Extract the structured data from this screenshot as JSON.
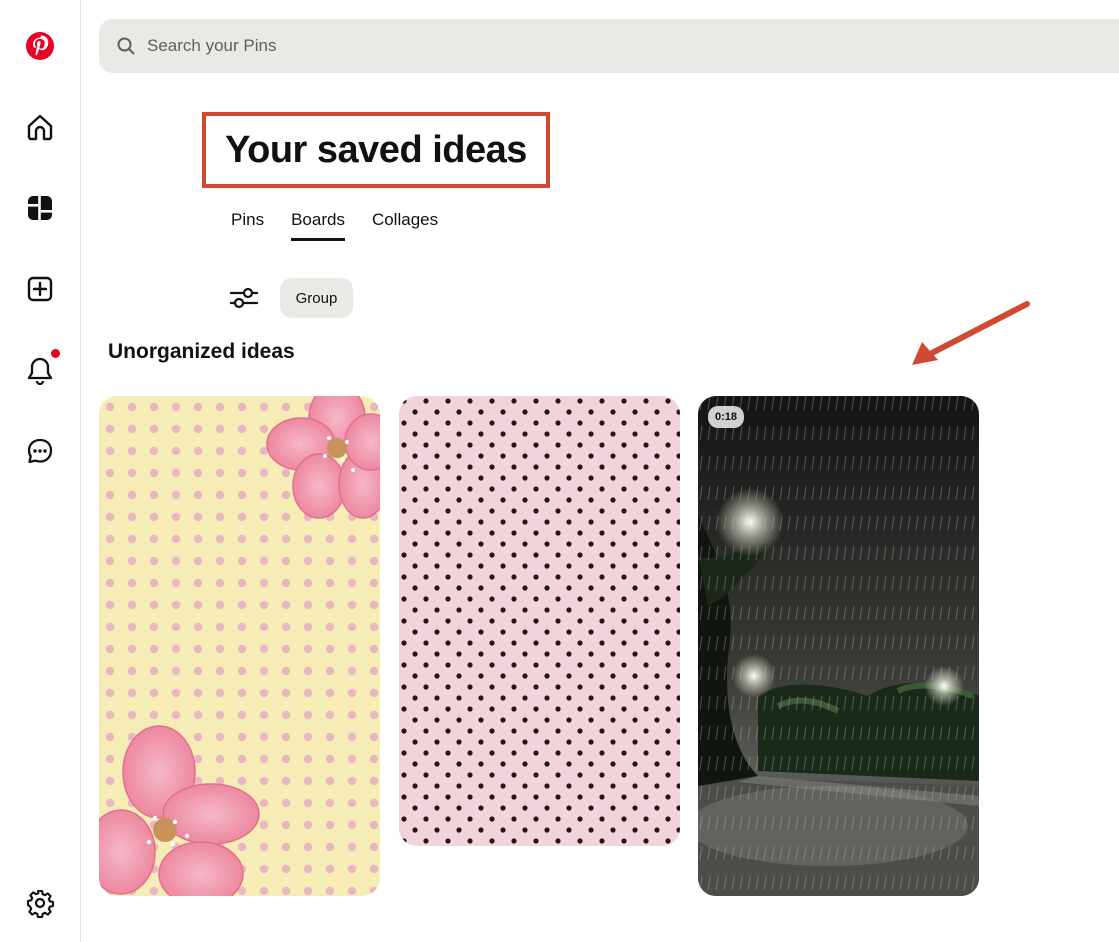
{
  "sidebar": {
    "items": [
      {
        "icon": "pinterest-logo"
      },
      {
        "icon": "home-icon"
      },
      {
        "icon": "explore-icon"
      },
      {
        "icon": "create-icon"
      },
      {
        "icon": "notifications-icon",
        "has_unread": true
      },
      {
        "icon": "messages-icon"
      },
      {
        "icon": "settings-icon"
      }
    ]
  },
  "search": {
    "placeholder": "Search your Pins",
    "value": ""
  },
  "page": {
    "title": "Your saved ideas"
  },
  "tabs": [
    {
      "label": "Pins",
      "active": false
    },
    {
      "label": "Boards",
      "active": true
    },
    {
      "label": "Collages",
      "active": false
    }
  ],
  "toolbar": {
    "filter_icon": "sliders-icon",
    "group_label": "Group"
  },
  "section": {
    "title": "Unorganized ideas"
  },
  "pins": [
    {
      "kind": "image",
      "description_icon": "pink-floral-polka-dot"
    },
    {
      "kind": "image",
      "description_icon": "pink-black-polka-dot"
    },
    {
      "kind": "video",
      "duration": "0:18",
      "description_icon": "rainy-night-street"
    }
  ],
  "colors": {
    "brand": "#e60023",
    "annotation": "#cf4a31",
    "chip_bg": "#e9e9e6"
  }
}
